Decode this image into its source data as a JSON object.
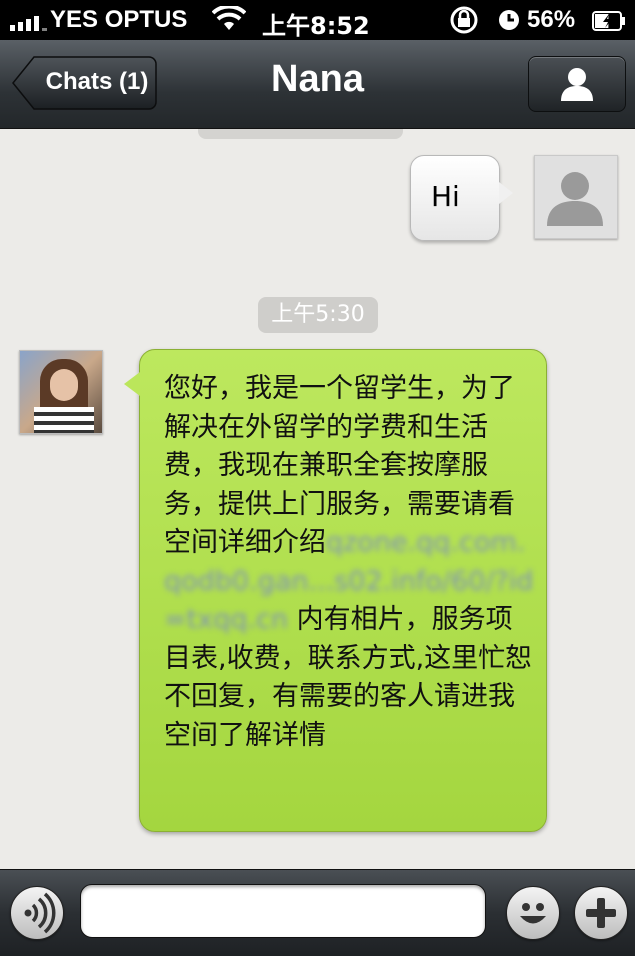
{
  "status_bar": {
    "carrier": "YES OPTUS",
    "time": "上午8:52",
    "battery": "56%",
    "signal_bars": 4,
    "battery_level": 0.56,
    "icons": [
      "signal-icon",
      "wifi-icon",
      "rotation-lock-icon",
      "alarm-icon",
      "battery-charging-icon"
    ]
  },
  "nav": {
    "back_label": "Chats (1)",
    "title": "Nana",
    "profile_icon": "person-icon"
  },
  "chat": {
    "messages": [
      {
        "from": "me",
        "text": "Hi"
      },
      {
        "from": "Nana",
        "time": "上午5:30",
        "text_before": "您好，我是一个留学生，为了解决在外留学的学费和生活费，我现在兼职全套按摩服务，提供上门服务，需要请看空间详细介绍",
        "link": "qzone.qq.com.qodb0.gan...s02.info/60/?id=txqq.cn",
        "text_after": " 内有相片，服务项目表,收费，联系方式,这里忙恕不回复，有需要的客人请进我空间了解详情"
      }
    ]
  },
  "input_bar": {
    "voice_icon": "voice-icon",
    "emoji_icon": "smiley-icon",
    "plus_icon": "plus-icon",
    "input_value": ""
  },
  "colors": {
    "bubble_green": "#a9d947",
    "nav_dark": "#2d3236",
    "chat_bg": "#ecebe8"
  }
}
